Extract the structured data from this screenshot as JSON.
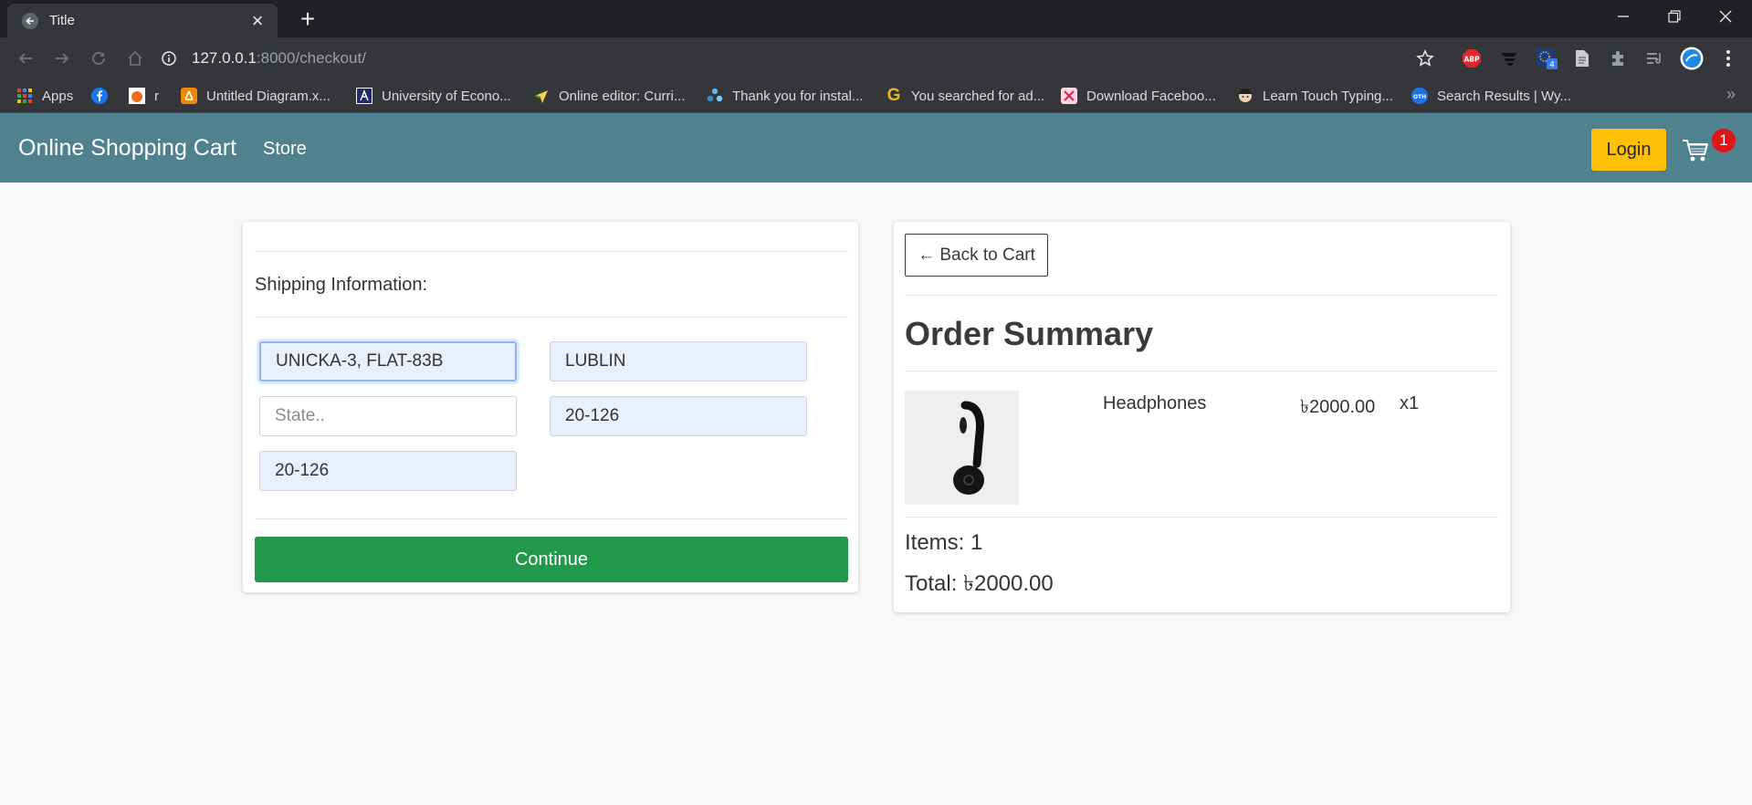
{
  "browser": {
    "tab_title": "Title",
    "url_host": "127.0.0.1",
    "url_path": ":8000/checkout/",
    "bookmarks": [
      {
        "label": "Apps",
        "icon": "apps-grid-icon"
      },
      {
        "label": "",
        "icon": "facebook-icon"
      },
      {
        "label": "r",
        "icon": "orange-square-icon"
      },
      {
        "label": "Untitled Diagram.x...",
        "icon": "drawio-icon"
      },
      {
        "label": "University of Econo...",
        "icon": "university-logo-icon"
      },
      {
        "label": "Online editor: Curri...",
        "icon": "editor-icon"
      },
      {
        "label": "Thank you for instal...",
        "icon": "puzzle-gear-icon"
      },
      {
        "label": "You searched for ad...",
        "icon": "g-logo-icon"
      },
      {
        "label": "Download Faceboo...",
        "icon": "download-app-icon"
      },
      {
        "label": "Learn Touch Typing...",
        "icon": "typing-avatar-icon"
      },
      {
        "label": "Search Results | Wy...",
        "icon": "search-results-icon"
      }
    ],
    "colors": {
      "tabbar": "#202124",
      "toolbar": "#35363a"
    }
  },
  "site": {
    "brand": "Online Shopping Cart",
    "store_link": "Store",
    "login_label": "Login",
    "cart_count": "1",
    "navbar_color": "#4f818f"
  },
  "shipping": {
    "label": "Shipping Information:",
    "address": "UNICKA-3, FLAT-83B",
    "city": "LUBLIN",
    "state_placeholder": "State..",
    "state": "",
    "zipcode": "20-126",
    "country": "20-126",
    "continue_label": "Continue",
    "continue_color": "#22994a"
  },
  "summary": {
    "back_label": "← Back to Cart",
    "title": "Order Summary",
    "items": [
      {
        "name": "Headphones",
        "price": "৳2000.00",
        "qty": "x1"
      }
    ],
    "items_count": "Items: 1",
    "total": "Total: ৳2000.00"
  }
}
